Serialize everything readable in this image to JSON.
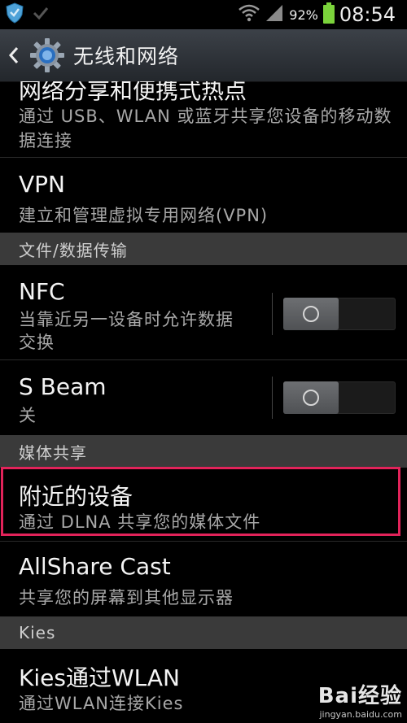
{
  "status_bar": {
    "battery_percent": "92%",
    "time": "08:54",
    "icons": [
      "shield-icon",
      "check-icon",
      "wifi-icon",
      "signal-icon",
      "battery-icon"
    ]
  },
  "action_bar": {
    "title": "无线和网络",
    "icons": [
      "back-arrow-icon",
      "settings-gear-icon"
    ]
  },
  "items": [
    {
      "title": "网络分享和便携式热点",
      "summary": "通过 USB、WLAN 或蓝牙共享您设备的移动数据连接"
    },
    {
      "title": "VPN",
      "summary": "建立和管理虚拟专用网络(VPN)"
    }
  ],
  "sections": {
    "file_transfer": "文件/数据传输",
    "media_share": "媒体共享",
    "kies": "Kies"
  },
  "nfc": {
    "title": "NFC",
    "summary_line1": "当靠近另一设备时允许数据",
    "summary_line2": "交换",
    "enabled": false
  },
  "sbeam": {
    "title": "S Beam",
    "summary": "关",
    "enabled": false
  },
  "nearby": {
    "title": "附近的设备",
    "summary": "通过 DLNA 共享您的媒体文件"
  },
  "allshare": {
    "title": "AllShare Cast",
    "summary": "共享您的屏幕到其他显示器"
  },
  "kies_wlan": {
    "title": "Kies通过WLAN",
    "summary": "通过WLAN连接Kies"
  },
  "colors": {
    "highlight": "#e2235a",
    "header_bg": "#3a3a3a",
    "background": "#000000"
  },
  "watermark": {
    "logo": "Bai经验",
    "url": "jingyan.baidu.com"
  }
}
